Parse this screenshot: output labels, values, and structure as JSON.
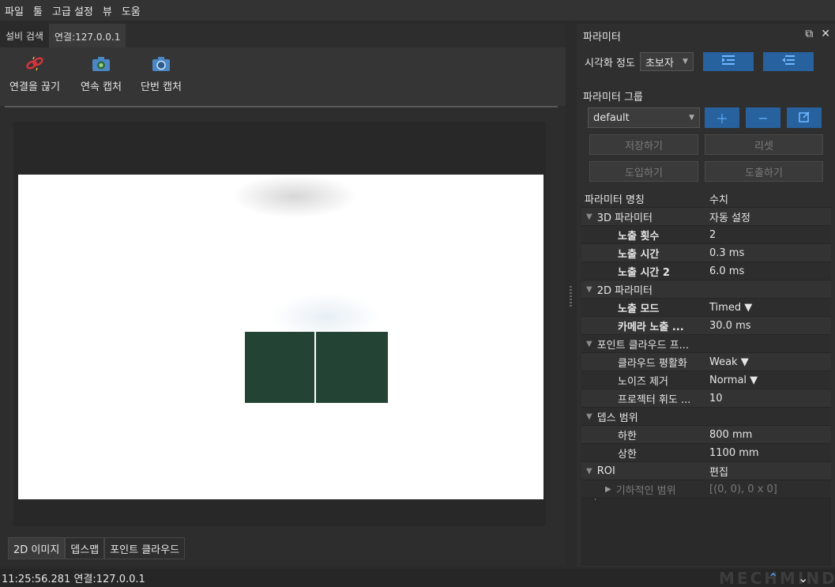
{
  "menu": [
    "파일",
    "툴",
    "고급 설정",
    "뷰",
    "도움"
  ],
  "tabs": [
    "설비 검색",
    "연결:127.0.0.1"
  ],
  "toolbar": {
    "disconnect": "연결을 끊기",
    "continuous": "연속 캡처",
    "single": "단번 캡처"
  },
  "bottom_tabs": [
    "2D 이미지",
    "뎁스맵",
    "포인트 클라우드"
  ],
  "panel": {
    "title": "파라미터",
    "visual_label": "시각화 정도",
    "visual_value": "초보자",
    "group_label": "파라미터 그룹",
    "group_value": "default",
    "save": "저장하기",
    "reset": "리셋",
    "import": "도입하기",
    "export": "도출하기"
  },
  "table": {
    "headers": [
      "파라미터 명칭",
      "수치"
    ],
    "rows": [
      {
        "name": "3D 파라미터",
        "value": "자동 설정"
      },
      {
        "name": "노출 횟수",
        "value": "2"
      },
      {
        "name": "노출 시간",
        "value": "0.3 ms"
      },
      {
        "name": "노출 시간 2",
        "value": "6.0 ms"
      },
      {
        "name": "2D 파라미터",
        "value": ""
      },
      {
        "name": "노출 모드",
        "value": "Timed ▼"
      },
      {
        "name": "카메라 노출 ...",
        "value": "30.0 ms"
      },
      {
        "name": "포인트 클라우드 프...",
        "value": ""
      },
      {
        "name": "클라우드 평활화",
        "value": "Weak ▼"
      },
      {
        "name": "노이즈 제거",
        "value": "Normal ▼"
      },
      {
        "name": "프로젝터 휘도 ...",
        "value": "10"
      },
      {
        "name": "뎁스 범위",
        "value": ""
      },
      {
        "name": "하한",
        "value": "800 mm"
      },
      {
        "name": "상한",
        "value": "1100 mm"
      },
      {
        "name": "ROI",
        "value": "편집"
      },
      {
        "name": "기하적인 범위",
        "value": "[(0, 0), 0 x 0]"
      }
    ]
  },
  "status": "11:25:56.281 연결:127.0.0.1",
  "watermark": "MECHMIND",
  "colors": {
    "accent": "#27619e",
    "box": "#234435"
  }
}
